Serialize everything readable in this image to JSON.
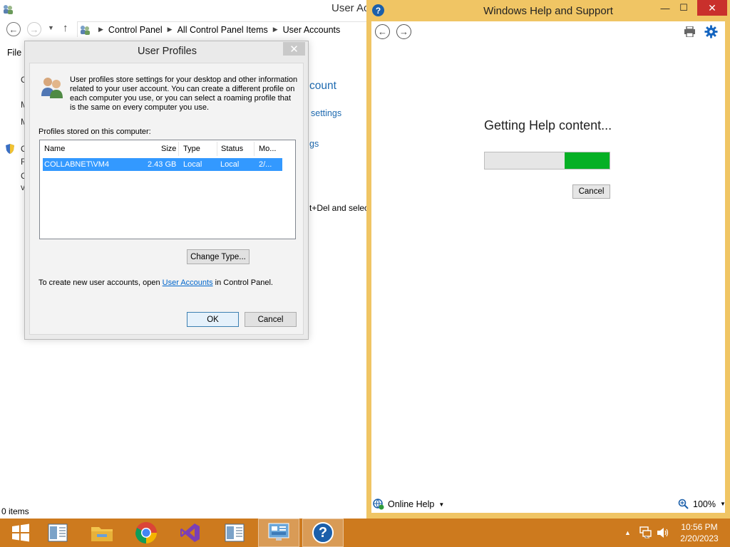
{
  "explorer": {
    "title": "User Ac",
    "address": [
      "Control Panel",
      "All Control Panel Items",
      "User Accounts"
    ],
    "menu_file": "File",
    "left_letters": [
      "C",
      "M",
      "M",
      "C",
      "R",
      "C",
      "v"
    ],
    "links": [
      "count",
      "settings",
      "gs"
    ],
    "partial_text": "t+Del and selec",
    "status": "0 items"
  },
  "dialog": {
    "title": "User Profiles",
    "close_glyph": "✕",
    "description": "User profiles store settings for your desktop and other information related to your user account. You can create a different profile on each computer you use, or you can select a roaming profile that is the same on every computer you use.",
    "profiles_label": "Profiles stored on this computer:",
    "columns": [
      "Name",
      "Size",
      "Type",
      "Status",
      "Mo..."
    ],
    "rows": [
      {
        "name": "COLLABNET\\VM4",
        "size": "2.43 GB",
        "type": "Local",
        "status": "Local",
        "modified": "2/..."
      }
    ],
    "change_type_label": "Change Type...",
    "info_prefix": "To create new user accounts, open ",
    "info_link": "User Accounts",
    "info_suffix": " in Control Panel.",
    "ok_label": "OK",
    "cancel_label": "Cancel"
  },
  "help": {
    "title": "Windows Help and Support",
    "status_text": "Getting Help content...",
    "progress": 0.36,
    "cancel_label": "Cancel",
    "online_help_label": "Online Help",
    "zoom_label": "100%",
    "progress_color": "#06b025",
    "accent_color": "#f0c564"
  },
  "taskbar": {
    "time": "10:56 PM",
    "date": "2/20/2023",
    "apps": [
      "windows-start-icon",
      "document-icon",
      "file-explorer-icon",
      "chrome-icon",
      "visual-studio-icon",
      "document-icon",
      "control-panel-icon",
      "help-icon"
    ],
    "color": "#cd7a1e"
  }
}
